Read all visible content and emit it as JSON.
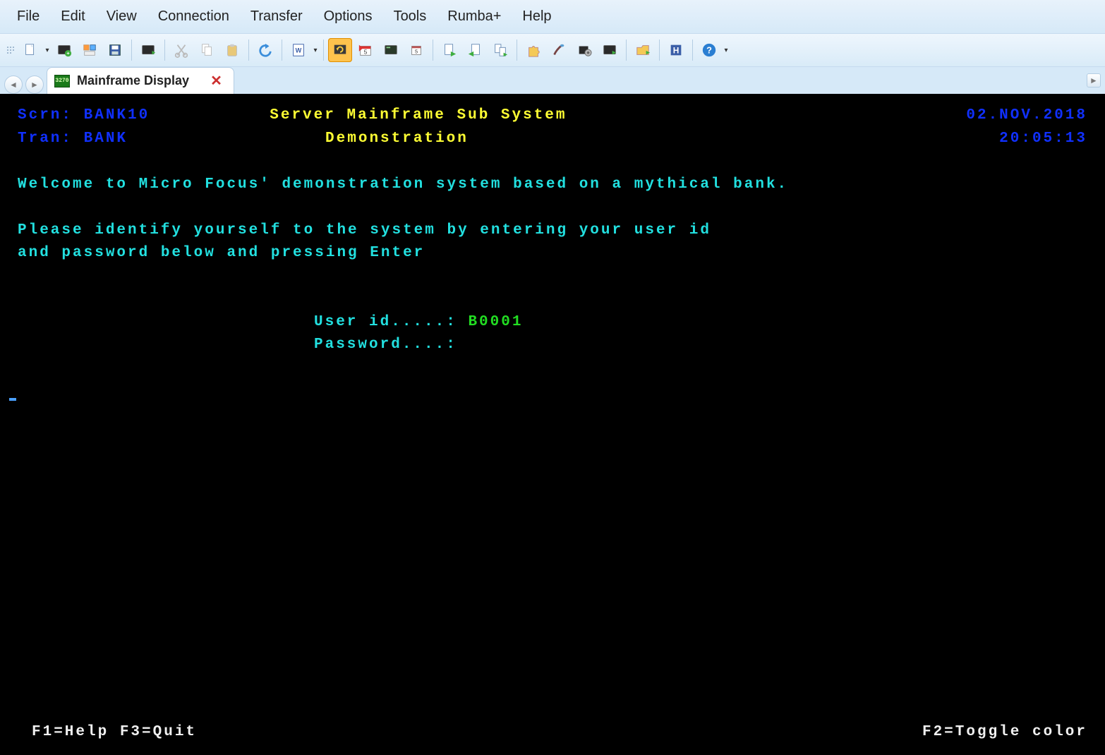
{
  "menu": {
    "file": "File",
    "edit": "Edit",
    "view": "View",
    "connection": "Connection",
    "transfer": "Transfer",
    "options": "Options",
    "tools": "Tools",
    "rumba": "Rumba+",
    "help": "Help"
  },
  "toolbar_icons": {
    "new": "new-file-icon",
    "open": "open-session-icon",
    "quick": "quick-connect-icon",
    "save": "save-icon",
    "connect": "connect-icon",
    "cut": "cut-icon",
    "copy": "copy-icon",
    "paste": "paste-icon",
    "undo": "undo-icon",
    "word": "word-doc-icon",
    "refresh": "refresh-icon",
    "calendar_flag": "calendar-flag-icon",
    "screen_dark": "screen-dark-icon",
    "calendar_small": "calendar-small-icon",
    "page_go": "page-go-icon",
    "page_back": "page-back-icon",
    "pages": "pages-icon",
    "puzzle": "puzzle-icon",
    "brush": "brush-icon",
    "config": "config-icon",
    "display": "display-settings-icon",
    "folder": "folder-open-icon",
    "history": "history-icon",
    "help_round": "help-icon"
  },
  "tab": {
    "title": "Mainframe Display",
    "icon_text": "3270"
  },
  "screen": {
    "scrn_label": "Scrn:",
    "scrn_value": "BANK10",
    "title1": "Server Mainframe Sub System",
    "date": "02.NOV.2018",
    "tran_label": "Tran:",
    "tran_value": "BANK",
    "title2": "Demonstration",
    "time": "20:05:13",
    "welcome": "Welcome to Micro Focus' demonstration system based on a mythical bank.",
    "instr1": "Please identify yourself to the system by entering your user id",
    "instr2": "and password below and pressing Enter",
    "userid_label": "User id.....:",
    "userid_value": "B0001",
    "password_label": "Password....:",
    "fkeys_left": "F1=Help F3=Quit",
    "fkeys_right": "F2=Toggle color"
  }
}
